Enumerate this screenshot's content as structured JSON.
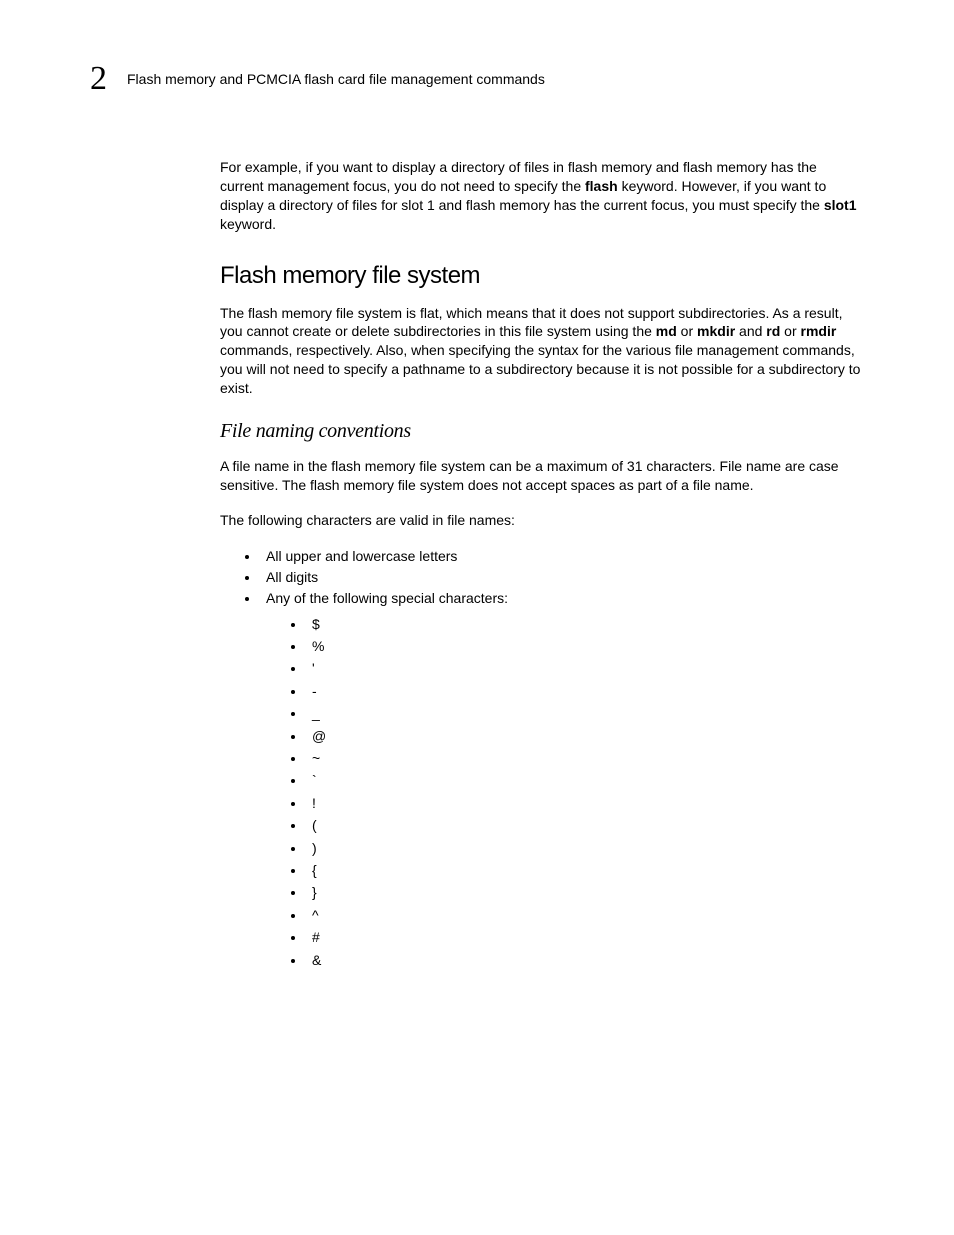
{
  "header": {
    "chapter": "2",
    "title": "Flash memory and PCMCIA flash card file management commands"
  },
  "intro": {
    "p1a": "For example, if you want to display a directory of files in flash memory and flash memory has the current management focus, you do not need to specify the ",
    "kw1": "flash",
    "p1b": " keyword. However, if you want to display a directory of files for slot 1 and flash memory has the current focus, you must specify the ",
    "kw2": "slot1",
    "p1c": " keyword."
  },
  "sec1": {
    "heading": "Flash memory file system",
    "p_a": "The flash memory file system is flat, which means that it does not support subdirectories. As a result, you cannot create or delete subdirectories in this file system using the ",
    "kw_md": "md",
    "p_b": " or ",
    "kw_mkdir": "mkdir",
    "p_c": " and ",
    "kw_rd": "rd",
    "p_d": " or ",
    "kw_rmdir": "rmdir",
    "p_e": " commands, respectively. Also, when specifying the syntax for the various file management commands, you will not need to specify a pathname to a subdirectory because it is not possible for a subdirectory to exist."
  },
  "sec2": {
    "heading": "File naming conventions",
    "p1": "A file name in the flash memory file system can be a maximum of 31 characters. File name are case sensitive. The flash memory file system does not accept spaces as part of a file name.",
    "p2": "The following characters are valid in file names:",
    "bullets": [
      "All upper and lowercase letters",
      "All digits",
      "Any of the following special characters:"
    ],
    "specials": [
      "$",
      "%",
      "'",
      "-",
      "_",
      "@",
      "~",
      "`",
      "!",
      "(",
      ")",
      "{",
      "}",
      "^",
      "#",
      "&"
    ]
  }
}
